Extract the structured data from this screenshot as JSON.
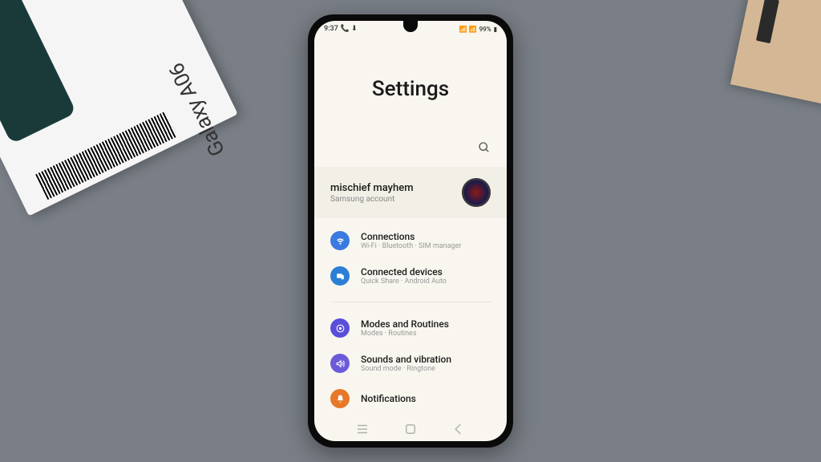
{
  "box_label": "Galaxy A06",
  "status_bar": {
    "time": "9:37",
    "battery": "99%"
  },
  "page_title": "Settings",
  "account": {
    "name": "mischief mayhem",
    "sub": "Samsung account"
  },
  "items": [
    {
      "title": "Connections",
      "sub": "Wi-Fi · Bluetooth · SIM manager",
      "color": "#3b7ae0"
    },
    {
      "title": "Connected devices",
      "sub": "Quick Share · Android Auto",
      "color": "#2b7fd4"
    }
  ],
  "items2": [
    {
      "title": "Modes and Routines",
      "sub": "Modes · Routines",
      "color": "#5b4fd9"
    },
    {
      "title": "Sounds and vibration",
      "sub": "Sound mode · Ringtone",
      "color": "#6b5bd9"
    },
    {
      "title": "Notifications",
      "sub": "",
      "color": "#e67828"
    }
  ]
}
